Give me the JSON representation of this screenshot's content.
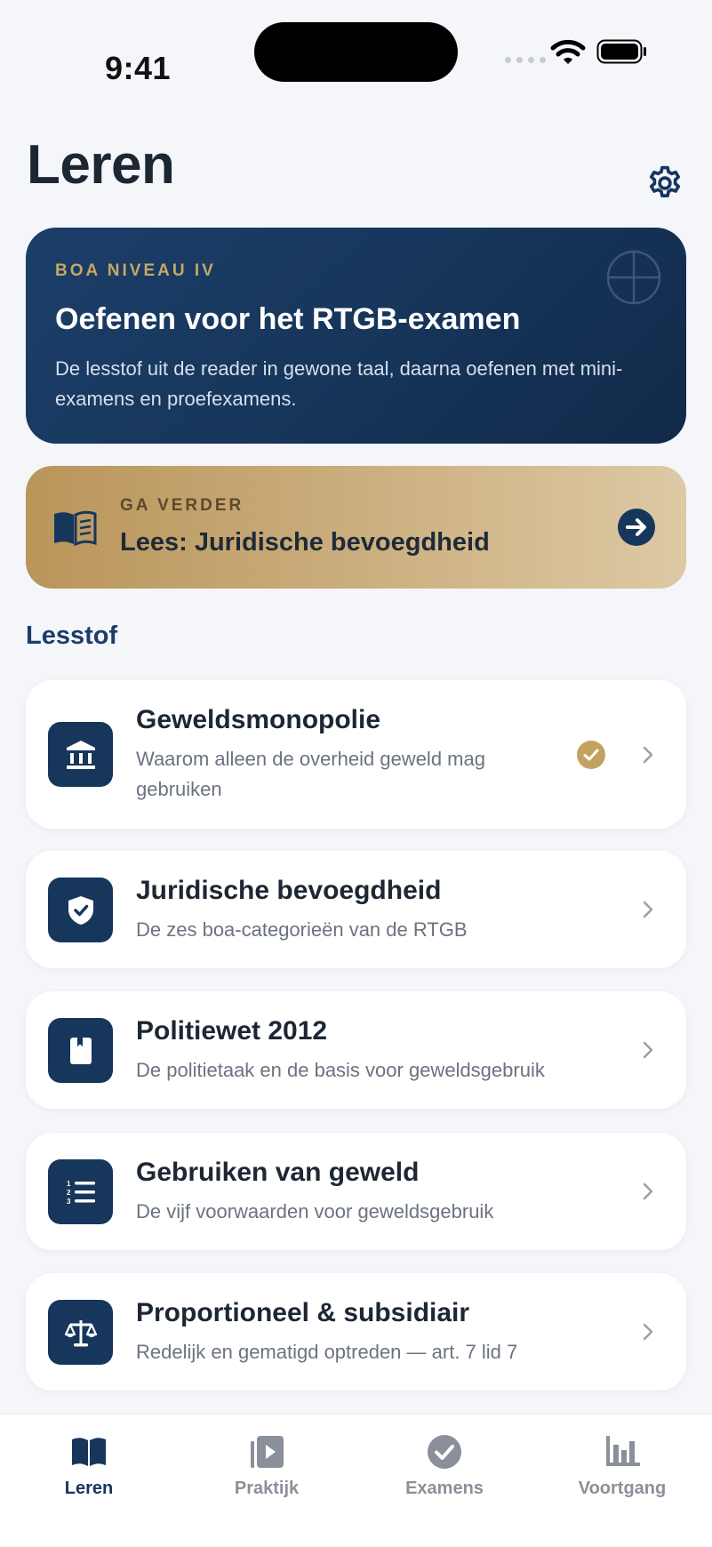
{
  "status_bar": {
    "time": "9:41"
  },
  "header": {
    "title": "Leren"
  },
  "hero": {
    "eyebrow": "BOA NIVEAU IV",
    "title": "Oefenen voor het RTGB-examen",
    "description": "De lesstof uit de reader in gewone taal, daarna oefenen met mini-examens en proefexamens."
  },
  "continue": {
    "eyebrow": "GA VERDER",
    "title": "Lees: Juridische bevoegdheid"
  },
  "section": {
    "title": "Lesstof"
  },
  "lessons": [
    {
      "title": "Geweldsmonopolie",
      "subtitle": "Waarom alleen de overheid geweld mag gebruiken",
      "icon": "bank-icon",
      "completed": true
    },
    {
      "title": "Juridische bevoegdheid",
      "subtitle": "De zes boa-categorieën van de RTGB",
      "icon": "shield-check-icon",
      "completed": false
    },
    {
      "title": "Politiewet 2012",
      "subtitle": "De politietaak en de basis voor geweldsgebruik",
      "icon": "book-icon",
      "completed": false
    },
    {
      "title": "Gebruiken van geweld",
      "subtitle": "De vijf voorwaarden voor geweldsgebruik",
      "icon": "numbered-list-icon",
      "completed": false
    },
    {
      "title": "Proportioneel & subsidiair",
      "subtitle": "Redelijk en gematigd optreden — art. 7 lid 7",
      "icon": "scale-icon",
      "completed": false
    }
  ],
  "tabs": [
    {
      "label": "Leren",
      "icon": "open-book-icon",
      "active": true
    },
    {
      "label": "Praktijk",
      "icon": "play-stack-icon",
      "active": false
    },
    {
      "label": "Examens",
      "icon": "check-circle-icon",
      "active": false
    },
    {
      "label": "Voortgang",
      "icon": "bar-chart-icon",
      "active": false
    }
  ],
  "colors": {
    "navy": "#17365c",
    "gold": "#c7a769",
    "completed": "#c3a161",
    "background": "#f4f6fa"
  }
}
